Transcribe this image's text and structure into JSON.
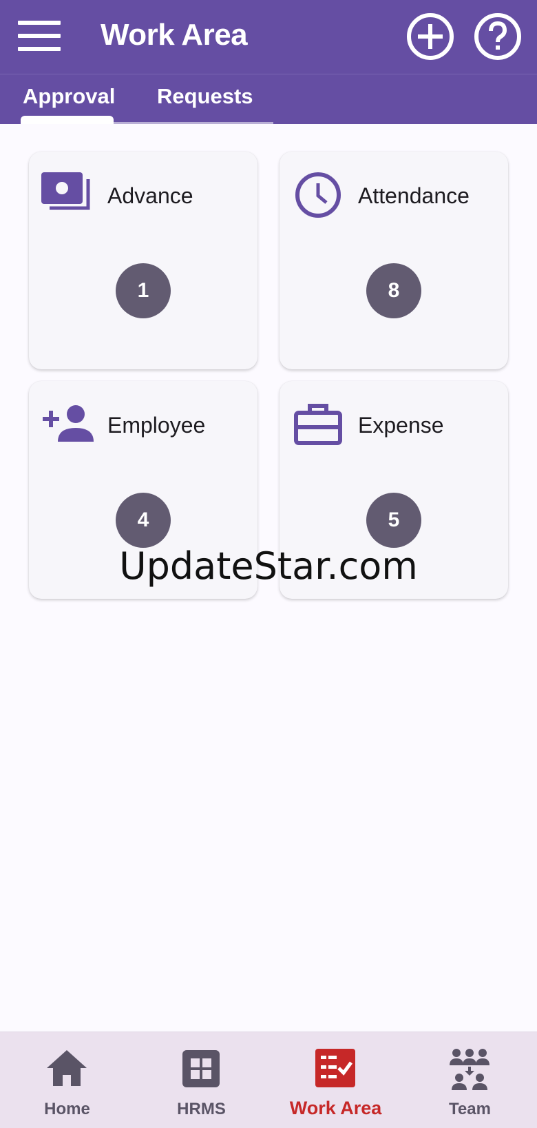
{
  "appbar": {
    "title": "Work Area",
    "icons": {
      "menu": "menu-icon",
      "add": "add-circle-icon",
      "help": "help-circle-icon"
    }
  },
  "tabs": [
    {
      "label": "Approval",
      "selected": true
    },
    {
      "label": "Requests",
      "selected": false
    }
  ],
  "cards": [
    {
      "label": "Advance",
      "count": "1",
      "icon": "money-icon"
    },
    {
      "label": "Attendance",
      "count": "8",
      "icon": "clock-icon"
    },
    {
      "label": "Employee",
      "count": "4",
      "icon": "add-person-icon"
    },
    {
      "label": "Expense",
      "count": "5",
      "icon": "briefcase-icon"
    }
  ],
  "watermark": "UpdateStar.com",
  "bottom_nav": [
    {
      "label": "Home",
      "icon": "home-icon",
      "active": false
    },
    {
      "label": "HRMS",
      "icon": "grid-icon",
      "active": false
    },
    {
      "label": "Work Area",
      "icon": "checklist-icon",
      "active": true
    },
    {
      "label": "Team",
      "icon": "team-icon",
      "active": false
    }
  ],
  "colors": {
    "primary": "#654ea3",
    "badge": "#625b71",
    "active_nav": "#c62828",
    "nav_bg": "#ebe1ee",
    "card_bg": "#f7f6fa"
  }
}
